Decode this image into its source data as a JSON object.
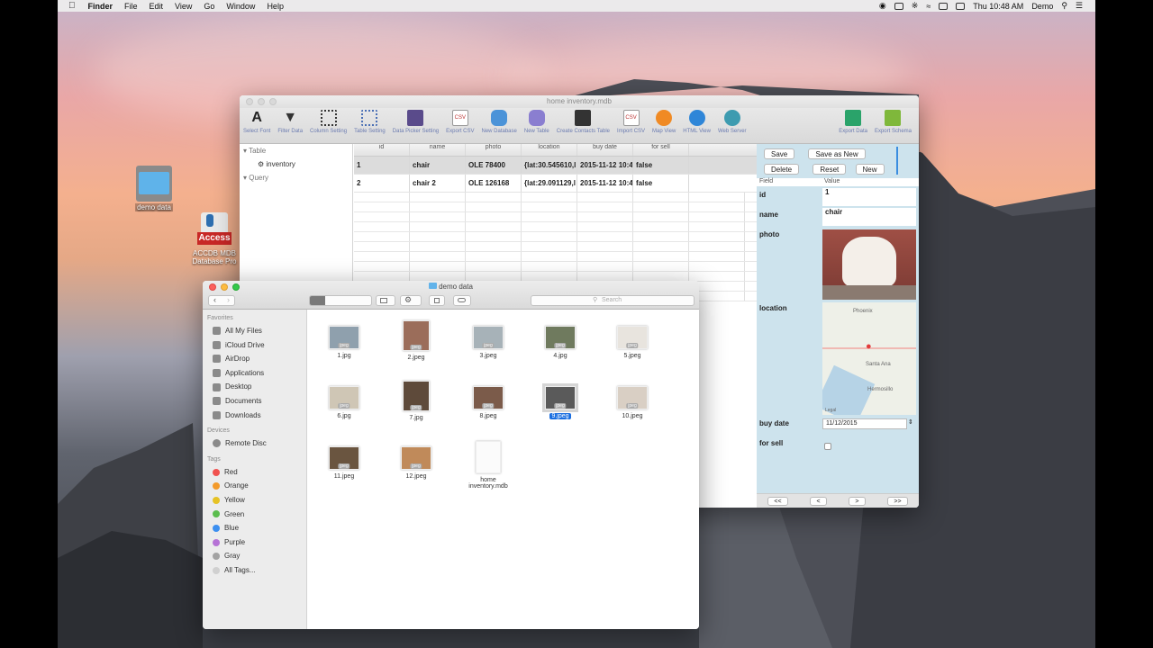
{
  "menubar": {
    "app": "Finder",
    "items": [
      "File",
      "Edit",
      "View",
      "Go",
      "Window",
      "Help"
    ],
    "clock": "Thu 10:48 AM",
    "user": "Demo"
  },
  "desktop": {
    "folder_label": "demo data",
    "app_badge": "Access",
    "app_label1": "ACCDB MDB",
    "app_label2": "Database Pro"
  },
  "access_window": {
    "title": "home inventory.mdb",
    "toolbar": [
      "Select Font",
      "Filter Data",
      "Column Setting",
      "Table Setting",
      "Data Picker Setting",
      "Export CSV",
      "New Database",
      "New Table",
      "Create Contacts Table",
      "Import CSV",
      "Map View",
      "HTML View",
      "Web Server"
    ],
    "toolbar_right": [
      "Export Data",
      "Export Schema"
    ],
    "sidebar": {
      "table_header": "Table",
      "table_item": "inventory",
      "query_header": "Query"
    },
    "grid": {
      "columns": [
        "id",
        "name",
        "photo",
        "location",
        "buy date",
        "for sell"
      ],
      "rows": [
        [
          "1",
          "chair",
          "OLE 78400",
          "{lat:30.545610,l",
          "2015-11-12 10:4",
          "false"
        ],
        [
          "2",
          "chair 2",
          "OLE 126168",
          "{lat:29.091129,l",
          "2015-11-12 10:4",
          "false"
        ]
      ]
    },
    "form": {
      "buttons": {
        "save": "Save",
        "save_as_new": "Save as New",
        "delete": "Delete",
        "reset": "Reset",
        "new": "New"
      },
      "header_field": "Field",
      "header_value": "Value",
      "fields": {
        "id_label": "id",
        "id_value": "1",
        "name_label": "name",
        "name_value": "chair",
        "photo_label": "photo",
        "location_label": "location",
        "buy_date_label": "buy date",
        "buy_date_value": "11/12/2015",
        "for_sell_label": "for sell"
      },
      "map_cities": [
        "Phoenix",
        "Santa Ana",
        "Hermosillo"
      ],
      "map_legal": "Legal"
    },
    "nav": [
      "<<",
      "<",
      ">",
      ">>"
    ]
  },
  "finder": {
    "title": "demo data",
    "search_placeholder": "Search",
    "favorites_header": "Favorites",
    "favorites": [
      "All My Files",
      "iCloud Drive",
      "AirDrop",
      "Applications",
      "Desktop",
      "Documents",
      "Downloads"
    ],
    "devices_header": "Devices",
    "devices": [
      "Remote Disc"
    ],
    "tags_header": "Tags",
    "tags": [
      {
        "name": "Red",
        "color": "#f0524f"
      },
      {
        "name": "Orange",
        "color": "#f39a2b"
      },
      {
        "name": "Yellow",
        "color": "#e6c224"
      },
      {
        "name": "Green",
        "color": "#5bbd4e"
      },
      {
        "name": "Blue",
        "color": "#3c8ff0"
      },
      {
        "name": "Purple",
        "color": "#b673d6"
      },
      {
        "name": "Gray",
        "color": "#a3a3a3"
      },
      {
        "name": "All Tags...",
        "color": "#d0d0d0"
      }
    ],
    "files": [
      "1.jpg",
      "2.jpeg",
      "3.jpeg",
      "4.jpg",
      "5.jpeg",
      "6.jpg",
      "7.jpg",
      "8.jpeg",
      "9.jpeg",
      "10.jpeg",
      "11.jpeg",
      "12.jpeg",
      "home inventory.mdb"
    ],
    "thumb_badge": "jpeg"
  }
}
